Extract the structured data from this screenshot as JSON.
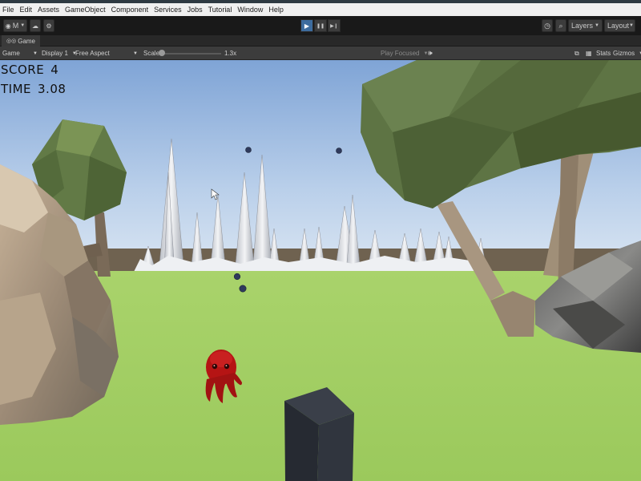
{
  "menu": [
    "File",
    "Edit",
    "Assets",
    "GameObject",
    "Component",
    "Services",
    "Jobs",
    "Tutorial",
    "Window",
    "Help"
  ],
  "toolbar": {
    "account_label": "M",
    "play_icon": "▶",
    "pause_icon": "❚❚",
    "step_icon": "▶❙",
    "layers_label": "Layers",
    "layout_label": "Layout"
  },
  "tab": {
    "label": "Game"
  },
  "gamebar": {
    "mode": "Game",
    "display": "Display 1",
    "aspect": "Free Aspect",
    "scale_label": "Scale",
    "scale_value": "1.3x",
    "play_focused": "Play Focused",
    "stats": "Stats",
    "gizmos": "Gizmos"
  },
  "hud": {
    "score_label": "SCORE",
    "score_value": "4",
    "time_label": "TIME",
    "time_value": "3.08"
  },
  "colors": {
    "play_active": "#3d6c9e",
    "grass": "#a5cf68",
    "tree_foliage": "#5e7444",
    "enemy": "#b51414",
    "cube": "#2c3038"
  }
}
